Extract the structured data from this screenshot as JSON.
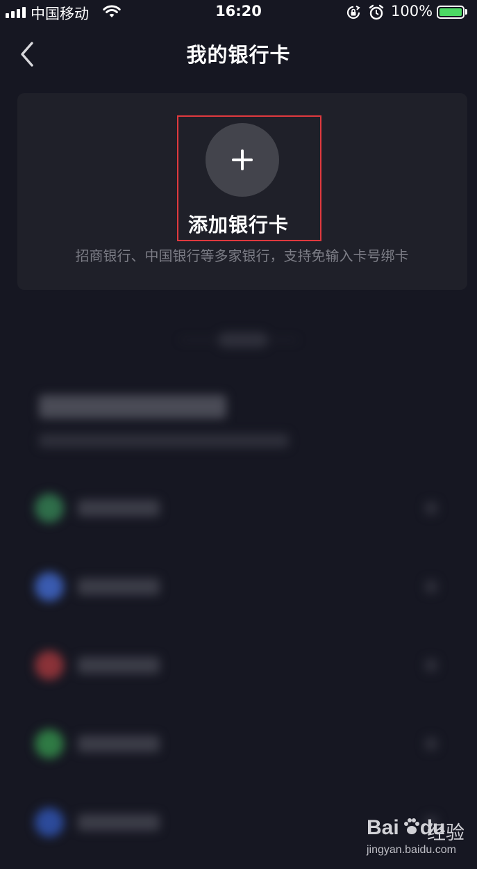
{
  "status_bar": {
    "carrier": "中国移动",
    "time": "16:20",
    "battery": "100%",
    "battery_level": 1.0
  },
  "nav": {
    "title": "我的银行卡",
    "back_icon": "chevron-left-icon"
  },
  "add_card": {
    "icon": "plus-icon",
    "label": "添加银行卡",
    "subtitle": "招商银行、中国银行等多家银行，支持免输入卡号绑卡"
  },
  "colors": {
    "background": "#161722",
    "panel": "#1f2029",
    "plus_circle": "#43444c",
    "highlight_border": "#e0393e",
    "subtitle_text": "#7c7d86",
    "battery_green": "#4cd964"
  },
  "blurred_bank_list": {
    "dot_colors": [
      "#2f6e4a",
      "#3a5bb0",
      "#8a3238",
      "#2f7a44",
      "#2c4a9a"
    ]
  },
  "watermark": {
    "logo": "Bai",
    "logo_suffix": "du",
    "cn": "经验",
    "url": "jingyan.baidu.com"
  }
}
